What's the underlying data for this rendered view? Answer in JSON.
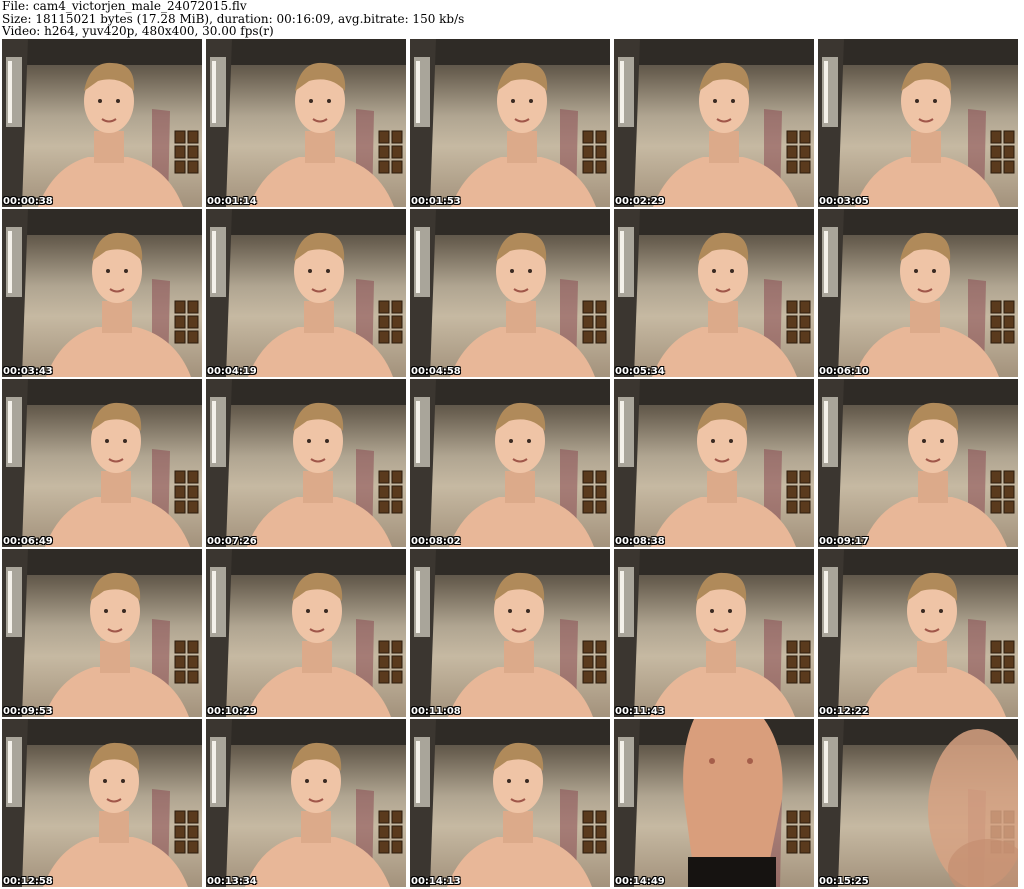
{
  "header": {
    "file_line": "File: cam4_victorjen_male_24072015.flv",
    "size_line": "Size: 18115021 bytes (17.28 MiB), duration: 00:16:09, avg.bitrate: 150 kb/s",
    "video_line": "Video: h264, yuv420p, 480x400, 30.00 fps(r)"
  },
  "frames": [
    {
      "timestamp": "00:00:38",
      "scene": "face"
    },
    {
      "timestamp": "00:01:14",
      "scene": "face"
    },
    {
      "timestamp": "00:01:53",
      "scene": "face"
    },
    {
      "timestamp": "00:02:29",
      "scene": "face"
    },
    {
      "timestamp": "00:03:05",
      "scene": "face"
    },
    {
      "timestamp": "00:03:43",
      "scene": "face"
    },
    {
      "timestamp": "00:04:19",
      "scene": "face"
    },
    {
      "timestamp": "00:04:58",
      "scene": "face"
    },
    {
      "timestamp": "00:05:34",
      "scene": "face"
    },
    {
      "timestamp": "00:06:10",
      "scene": "face"
    },
    {
      "timestamp": "00:06:49",
      "scene": "face"
    },
    {
      "timestamp": "00:07:26",
      "scene": "face"
    },
    {
      "timestamp": "00:08:02",
      "scene": "face"
    },
    {
      "timestamp": "00:08:38",
      "scene": "face"
    },
    {
      "timestamp": "00:09:17",
      "scene": "face"
    },
    {
      "timestamp": "00:09:53",
      "scene": "face"
    },
    {
      "timestamp": "00:10:29",
      "scene": "face"
    },
    {
      "timestamp": "00:11:08",
      "scene": "face"
    },
    {
      "timestamp": "00:11:43",
      "scene": "face"
    },
    {
      "timestamp": "00:12:22",
      "scene": "face"
    },
    {
      "timestamp": "00:12:58",
      "scene": "face"
    },
    {
      "timestamp": "00:13:34",
      "scene": "face"
    },
    {
      "timestamp": "00:14:13",
      "scene": "face"
    },
    {
      "timestamp": "00:14:49",
      "scene": "torso"
    },
    {
      "timestamp": "00:15:25",
      "scene": "blur"
    }
  ]
}
